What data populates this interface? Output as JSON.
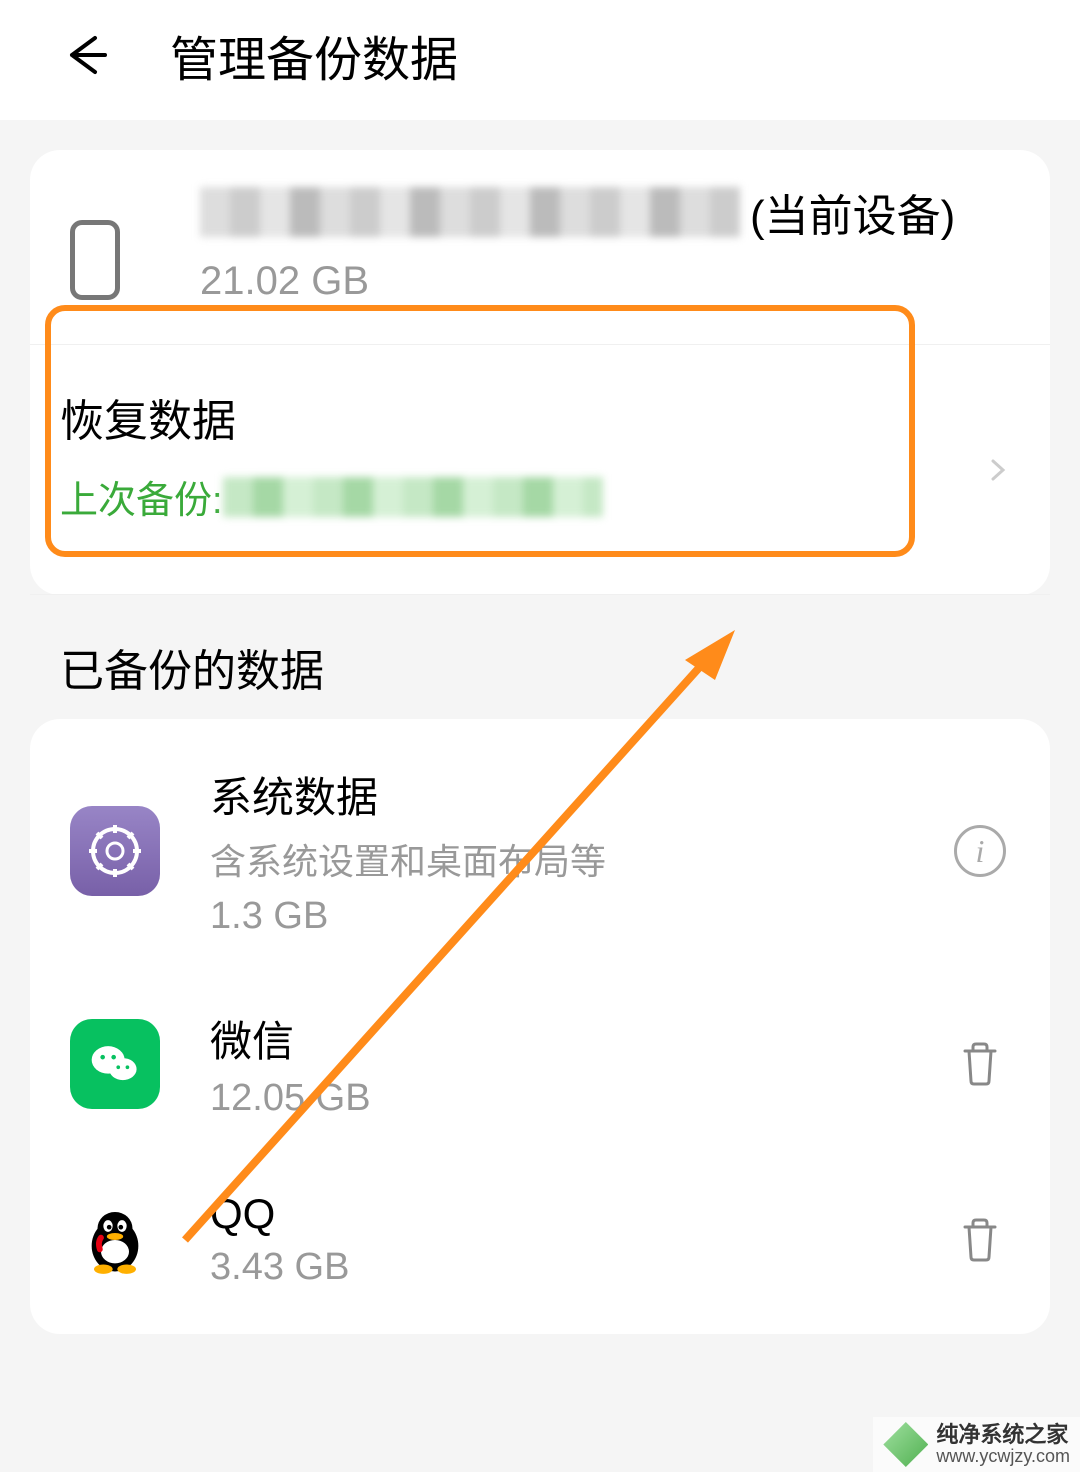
{
  "header": {
    "title": "管理备份数据"
  },
  "device": {
    "suffix": "(当前设备)",
    "size": "21.02 GB"
  },
  "restore": {
    "title": "恢复数据",
    "last_backup_label": "上次备份: "
  },
  "backed_up_section_title": "已备份的数据",
  "items": [
    {
      "name": "系统数据",
      "desc": "含系统设置和桌面布局等",
      "size": "1.3 GB",
      "icon": "gear",
      "action": "info"
    },
    {
      "name": "微信",
      "desc": "",
      "size": "12.05 GB",
      "icon": "wechat",
      "action": "delete"
    },
    {
      "name": "QQ",
      "desc": "",
      "size": "3.43 GB",
      "icon": "qq",
      "action": "delete"
    }
  ],
  "watermark": {
    "name": "纯净系统之家",
    "url": "www.ycwjzy.com"
  }
}
